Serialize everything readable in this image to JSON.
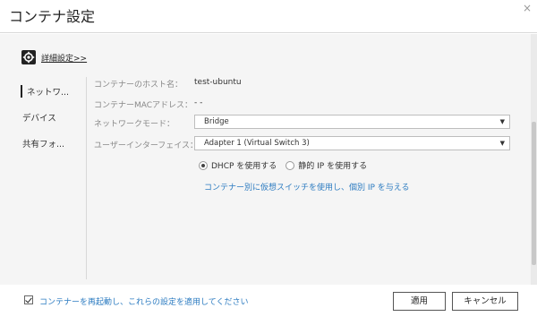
{
  "dialog": {
    "title": "コンテナ設定",
    "close": "×"
  },
  "advanced": {
    "label": "詳細設定>>"
  },
  "sidebar": {
    "items": [
      {
        "label": "ネットワ..."
      },
      {
        "label": "デバイス"
      },
      {
        "label": "共有フォ..."
      }
    ]
  },
  "network": {
    "host_label": "コンテナーのホスト名：",
    "host_value": "test-ubuntu",
    "mac_label": "コンテナーMACアドレス：",
    "mac_value": "- -",
    "mode_label": "ネットワークモード：",
    "mode_value": "Bridge",
    "iface_label": "ユーザーインターフェイス：",
    "iface_value": "Adapter 1 (Virtual Switch 3)",
    "dhcp_label": "DHCP を使用する",
    "static_label": "静的 IP を使用する",
    "link": "コンテナー別に仮想スイッチを使用し、個別 IP を与える"
  },
  "footer": {
    "apply_restart_label": "コンテナーを再起動し、これらの設定を適用してください",
    "apply_button": "適用",
    "cancel_button": "キャンセル"
  },
  "colors": {
    "link": "#2d7cc1",
    "background": "#f5f5f5"
  }
}
